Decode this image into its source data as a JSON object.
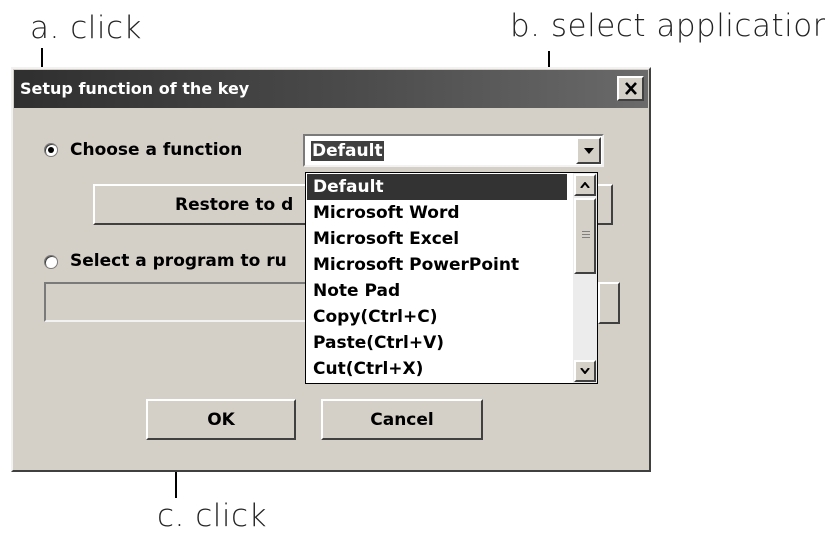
{
  "annotations": {
    "a": "a. click",
    "b": "b. select application",
    "c": "c. click"
  },
  "dialog": {
    "title": "Setup function of the key",
    "close_icon": "close-icon",
    "choose_function_label": "Choose a function",
    "combo_value": "Default",
    "restore_button": "Restore to d",
    "select_program_label": "Select a program to ru",
    "ok_button": "OK",
    "cancel_button": "Cancel",
    "dropdown_items": [
      "Default",
      "Microsoft Word",
      "Microsoft Excel",
      "Microsoft PowerPoint",
      "Note Pad",
      "Copy(Ctrl+C)",
      "Paste(Ctrl+V)",
      "Cut(Ctrl+X)"
    ],
    "selected_item": "Default",
    "choose_function_checked": true,
    "select_program_checked": false
  },
  "colors": {
    "dialog_bg": "#d4d0c8",
    "titlebar": "#3a3a3a",
    "selection": "#333333"
  }
}
